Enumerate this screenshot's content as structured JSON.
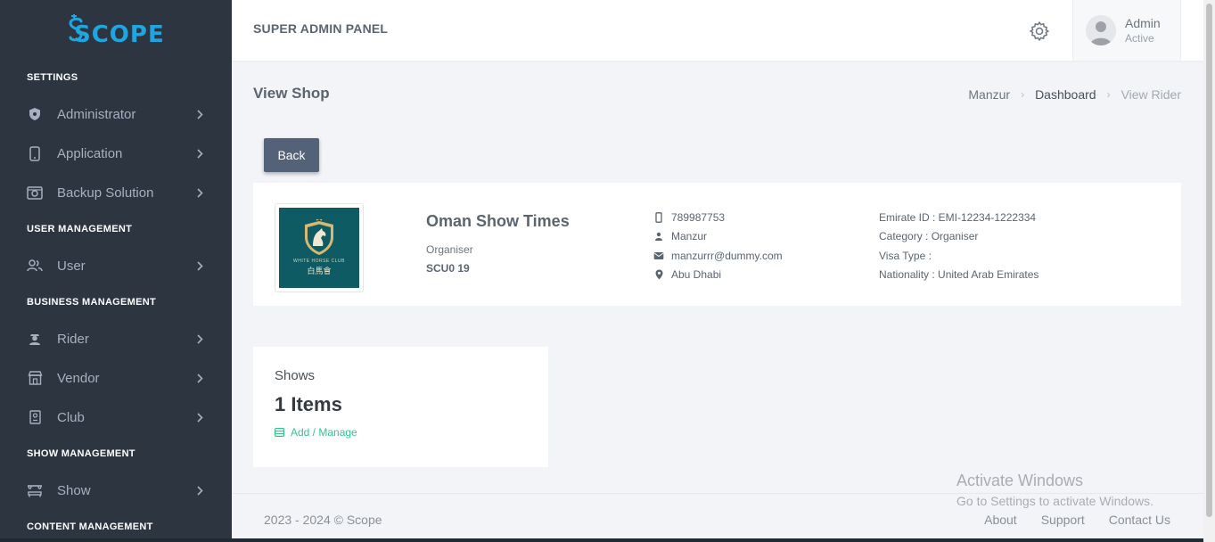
{
  "brand": {
    "logo_text": "SCOPE",
    "accent": "#1fa6e0"
  },
  "sidebar": {
    "sections": [
      {
        "title": "SETTINGS",
        "items": [
          {
            "label": "Administrator",
            "icon": "shield-icon"
          },
          {
            "label": "Application",
            "icon": "phone-icon"
          },
          {
            "label": "Backup Solution",
            "icon": "backup-icon"
          }
        ]
      },
      {
        "title": "USER MANAGEMENT",
        "items": [
          {
            "label": "User",
            "icon": "users-icon"
          }
        ]
      },
      {
        "title": "BUSINESS MANAGEMENT",
        "items": [
          {
            "label": "Rider",
            "icon": "rider-icon"
          },
          {
            "label": "Vendor",
            "icon": "store-icon"
          },
          {
            "label": "Club",
            "icon": "building-icon"
          }
        ]
      },
      {
        "title": "SHOW MANAGEMENT",
        "items": [
          {
            "label": "Show",
            "icon": "stage-icon"
          }
        ]
      },
      {
        "title": "CONTENT MANAGEMENT",
        "items": []
      }
    ]
  },
  "header": {
    "title": "SUPER ADMIN PANEL",
    "user": {
      "name": "Admin",
      "status": "Active"
    }
  },
  "page": {
    "title": "View Shop",
    "breadcrumb": [
      "Manzur",
      "Dashboard",
      "View Rider"
    ],
    "back_label": "Back"
  },
  "shop": {
    "name": "Oman Show Times",
    "role": "Organiser",
    "code": "SCU0 19",
    "image_caption": "WHITE HORSE CLUB",
    "image_chinese": "白馬會",
    "contact": {
      "phone": "789987753",
      "person": "Manzur",
      "email": "manzurrr@dummy.com",
      "location": "Abu Dhabi"
    },
    "meta": {
      "emirate_id": "Emirate ID : EMI-12234-1222334",
      "category": "Category : Organiser",
      "visa_type": "Visa Type :",
      "nationality": "Nationality : United Arab Emirates"
    }
  },
  "shows": {
    "title": "Shows",
    "count": "1 Items",
    "link": "Add / Manage"
  },
  "footer": {
    "copyright": "2023 - 2024 © Scope",
    "links": [
      "About",
      "Support",
      "Contact Us"
    ]
  },
  "watermark": {
    "title": "Activate Windows",
    "subtitle": "Go to Settings to activate Windows."
  }
}
